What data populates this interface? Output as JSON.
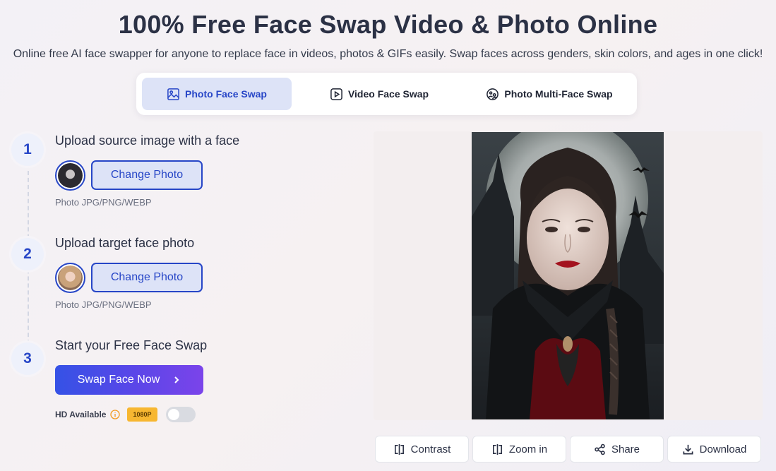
{
  "header": {
    "title": "100% Free Face Swap Video & Photo Online",
    "subtitle": "Online free AI face swapper for anyone to replace face in videos, photos & GIFs easily. Swap faces across genders, skin colors, and ages in one click!"
  },
  "tabs": [
    {
      "label": "Photo Face Swap",
      "icon": "image-icon",
      "active": true
    },
    {
      "label": "Video Face Swap",
      "icon": "play-icon",
      "active": false
    },
    {
      "label": "Photo Multi-Face Swap",
      "icon": "faces-icon",
      "active": false
    }
  ],
  "steps": [
    {
      "number": "1",
      "title": "Upload source image with a face",
      "button": "Change Photo",
      "hint": "Photo JPG/PNG/WEBP"
    },
    {
      "number": "2",
      "title": "Upload target face photo",
      "button": "Change Photo",
      "hint": "Photo JPG/PNG/WEBP"
    },
    {
      "number": "3",
      "title": "Start your Free Face Swap",
      "button": "Swap Face Now"
    }
  ],
  "hd": {
    "label": "HD Available",
    "badge": "1080P",
    "enabled": false
  },
  "actions": [
    {
      "label": "Contrast",
      "icon": "contrast-icon"
    },
    {
      "label": "Zoom in",
      "icon": "zoom-in-icon"
    },
    {
      "label": "Share",
      "icon": "share-icon"
    },
    {
      "label": "Download",
      "icon": "download-icon"
    }
  ],
  "colors": {
    "accent": "#2746c7",
    "accent_light": "#dde3f7",
    "badge": "#f7b731",
    "gradient_start": "#3552e6",
    "gradient_end": "#7b44ea"
  }
}
